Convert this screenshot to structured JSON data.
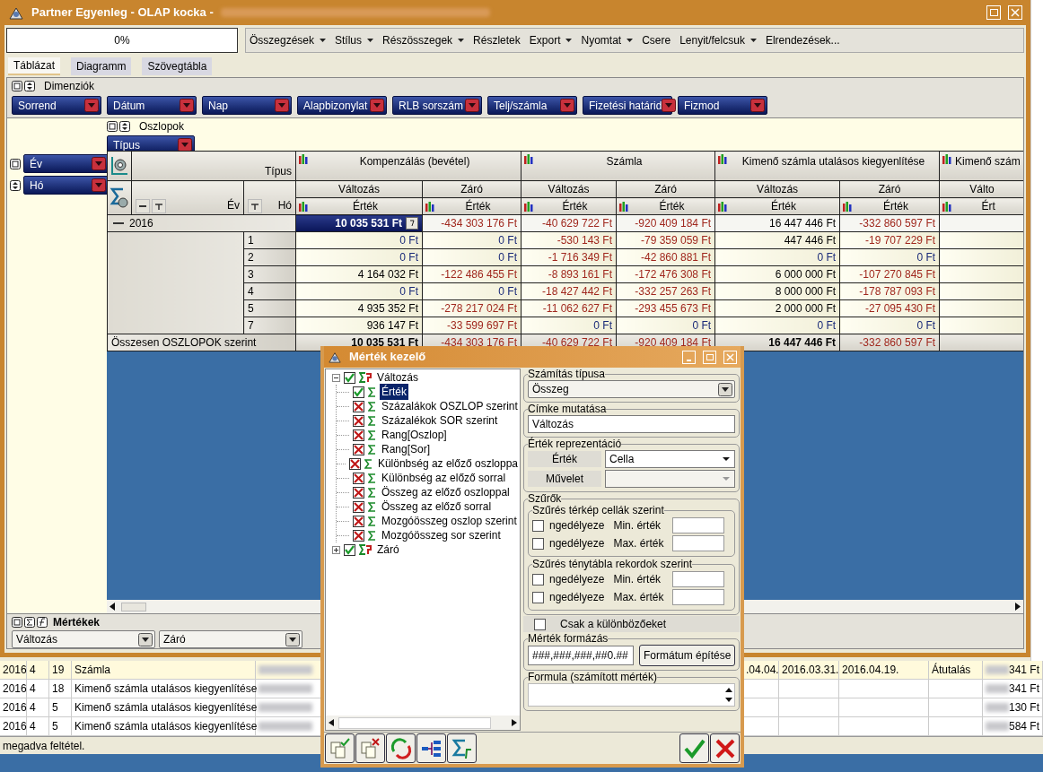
{
  "background_table": {
    "rows": [
      {
        "selected": true,
        "column_1": "2016",
        "column_2": "4",
        "column_3": "19",
        "column_4": "Számla",
        "column_6": ".04.04.",
        "column_7": "2016.03.31.",
        "column_8": "2016.04.19.",
        "column_9": "Átutalás",
        "column_10": "341 Ft"
      },
      {
        "selected": false,
        "column_1": "2016",
        "column_2": "4",
        "column_3": "18",
        "column_4": "Kimenő számla utalásos kiegyenlítése",
        "column_10": "341 Ft"
      },
      {
        "selected": false,
        "column_1": "2016",
        "column_2": "4",
        "column_3": "5",
        "column_4": "Kimenő számla utalásos kiegyenlítése",
        "column_10": "130 Ft"
      },
      {
        "selected": false,
        "column_1": "2016",
        "column_2": "4",
        "column_3": "5",
        "column_4": "Kimenő számla utalásos kiegyenlítése",
        "column_10": "584 Ft"
      }
    ],
    "status_bar": "megadva feltétel."
  },
  "main_window": {
    "title": "Partner Egyenleg - OLAP kocka -",
    "progress": "0%",
    "menu": [
      {
        "label": "Összegzések",
        "dropdown": true
      },
      {
        "label": "Stílus",
        "dropdown": true
      },
      {
        "label": "Részösszegek",
        "dropdown": true
      },
      {
        "label": "Részletek",
        "dropdown": false
      },
      {
        "label": "Export",
        "dropdown": true
      },
      {
        "label": "Nyomtat",
        "dropdown": true
      },
      {
        "label": "Csere",
        "dropdown": false
      },
      {
        "label": "Lenyit/felcsuk",
        "dropdown": true
      },
      {
        "label": "Elrendezések...",
        "dropdown": false
      }
    ],
    "tabs": [
      {
        "label": "Táblázat",
        "selected": true
      },
      {
        "label": "Diagramm",
        "selected": false
      },
      {
        "label": "Szövegtábla",
        "selected": false
      }
    ],
    "dimensions": {
      "title": "Dimenziók",
      "fields": [
        "Sorrend",
        "Dátum",
        "Nap",
        "Alapbizonylat",
        "RLB sorszám",
        "Telj/számla",
        "Fizetési határid",
        "Fizmod"
      ]
    },
    "columns_area": {
      "title": "Oszlopok",
      "fields": [
        "Típus"
      ]
    },
    "row_fields": [
      "Év",
      "Hó"
    ],
    "pivot": {
      "column_field": "Típus",
      "row_labels": [
        "Év",
        "Hó"
      ],
      "groups": [
        {
          "label": "Kompenzálás (bevétel)",
          "measures": [
            {
              "label": "Változás",
              "sub": "Érték"
            },
            {
              "label": "Záró",
              "sub": "Érték"
            }
          ]
        },
        {
          "label": "Számla",
          "measures": [
            {
              "label": "Változás",
              "sub": "Érték"
            },
            {
              "label": "Záró",
              "sub": "Érték"
            }
          ]
        },
        {
          "label": "Kimenő számla utalásos kiegyenlítése",
          "measures": [
            {
              "label": "Változás",
              "sub": "Érték"
            },
            {
              "label": "Záró",
              "sub": "Érték"
            }
          ]
        },
        {
          "label": "Kimenő szám",
          "measures": [
            {
              "label": "Válto",
              "sub": "Ért"
            }
          ]
        }
      ],
      "year": {
        "label": "2016",
        "cells": [
          {
            "value": "10 035 531 Ft",
            "selected": true
          },
          {
            "value": "-434 303 176 Ft",
            "color": "#a0281e",
            "selected": false
          },
          {
            "value": "-40 629 722 Ft",
            "color": "#a0281e",
            "selected": false
          },
          {
            "value": "-920 409 184 Ft",
            "color": "#a0281e",
            "selected": false
          },
          {
            "value": "16 447 446 Ft",
            "color": "#000000",
            "selected": false
          },
          {
            "value": "-332 860 597 Ft",
            "color": "#a0281e",
            "selected": false
          }
        ]
      },
      "months": [
        {
          "label": "1",
          "cells": [
            {
              "value": "0 Ft",
              "color": "#1a2a78",
              "selected": false
            },
            {
              "value": "0 Ft",
              "color": "#1a2a78",
              "selected": false
            },
            {
              "value": "-530 143 Ft",
              "color": "#a0281e",
              "selected": false
            },
            {
              "value": "-79 359 059 Ft",
              "color": "#a0281e",
              "selected": false
            },
            {
              "value": "447 446 Ft",
              "color": "#000000",
              "selected": false
            },
            {
              "value": "-19 707 229 Ft",
              "color": "#a0281e",
              "selected": false
            }
          ]
        },
        {
          "label": "2",
          "cells": [
            {
              "value": "0 Ft",
              "color": "#1a2a78",
              "selected": false
            },
            {
              "value": "0 Ft",
              "color": "#1a2a78",
              "selected": false
            },
            {
              "value": "-1 716 349 Ft",
              "color": "#a0281e",
              "selected": false
            },
            {
              "value": "-42 860 881 Ft",
              "color": "#a0281e",
              "selected": false
            },
            {
              "value": "0 Ft",
              "color": "#1a2a78",
              "selected": false
            },
            {
              "value": "0 Ft",
              "color": "#1a2a78",
              "selected": false
            }
          ]
        },
        {
          "label": "3",
          "cells": [
            {
              "value": "4 164 032 Ft",
              "color": "#000000",
              "selected": false
            },
            {
              "value": "-122 486 455 Ft",
              "color": "#a0281e",
              "selected": false
            },
            {
              "value": "-8 893 161 Ft",
              "color": "#a0281e",
              "selected": false
            },
            {
              "value": "-172 476 308 Ft",
              "color": "#a0281e",
              "selected": false
            },
            {
              "value": "6 000 000 Ft",
              "color": "#000000",
              "selected": false
            },
            {
              "value": "-107 270 845 Ft",
              "color": "#a0281e",
              "selected": false
            }
          ]
        },
        {
          "label": "4",
          "cells": [
            {
              "value": "0 Ft",
              "color": "#1a2a78",
              "selected": false
            },
            {
              "value": "0 Ft",
              "color": "#1a2a78",
              "selected": false
            },
            {
              "value": "-18 427 442 Ft",
              "color": "#a0281e",
              "selected": false
            },
            {
              "value": "-332 257 263 Ft",
              "color": "#a0281e",
              "selected": false
            },
            {
              "value": "8 000 000 Ft",
              "color": "#000000",
              "selected": false
            },
            {
              "value": "-178 787 093 Ft",
              "color": "#a0281e",
              "selected": false
            }
          ]
        },
        {
          "label": "5",
          "cells": [
            {
              "value": "4 935 352 Ft",
              "color": "#000000",
              "selected": false
            },
            {
              "value": "-278 217 024 Ft",
              "color": "#a0281e",
              "selected": false
            },
            {
              "value": "-11 062 627 Ft",
              "color": "#a0281e",
              "selected": false
            },
            {
              "value": "-293 455 673 Ft",
              "color": "#a0281e",
              "selected": false
            },
            {
              "value": "2 000 000 Ft",
              "color": "#000000",
              "selected": false
            },
            {
              "value": "-27 095 430 Ft",
              "color": "#a0281e",
              "selected": false
            }
          ]
        },
        {
          "label": "7",
          "cells": [
            {
              "value": "936 147 Ft",
              "color": "#000000",
              "selected": false
            },
            {
              "value": "-33 599 697 Ft",
              "color": "#a0281e",
              "selected": false
            },
            {
              "value": "0 Ft",
              "color": "#1a2a78",
              "selected": false
            },
            {
              "value": "0 Ft",
              "color": "#1a2a78",
              "selected": false
            },
            {
              "value": "0 Ft",
              "color": "#1a2a78",
              "selected": false
            },
            {
              "value": "0 Ft",
              "color": "#1a2a78",
              "selected": false
            }
          ]
        }
      ],
      "total": {
        "label": "Összesen OSZLOPOK szerint",
        "cells": [
          {
            "value": "10 035 531 Ft",
            "color": "#000000",
            "bold": true,
            "selected": false
          },
          {
            "value": "-434 303 176 Ft",
            "color": "#a0281e",
            "bold": false,
            "selected": false
          },
          {
            "value": "-40 629 722 Ft",
            "color": "#a0281e",
            "bold": false,
            "selected": false
          },
          {
            "value": "-920 409 184 Ft",
            "color": "#a0281e",
            "bold": false,
            "selected": false
          },
          {
            "value": "16 447 446 Ft",
            "color": "#000000",
            "bold": true,
            "selected": false
          },
          {
            "value": "-332 860 597 Ft",
            "color": "#a0281e",
            "bold": false,
            "selected": false
          }
        ]
      }
    },
    "measures": {
      "title": "Mértékek",
      "fields": [
        "Változás",
        "Záró"
      ]
    }
  },
  "dialog": {
    "title": "Mérték kezelő",
    "tree": [
      {
        "label": "Változás",
        "checked": true,
        "selected": false,
        "expanded": true,
        "children": [
          {
            "label": "Érték",
            "checked": true,
            "selected": true
          },
          {
            "label": "Százalákok OSZLOP szerint",
            "checked": false,
            "selected": false
          },
          {
            "label": "Százalékok SOR szerint",
            "checked": false,
            "selected": false
          },
          {
            "label": "Rang[Oszlop]",
            "checked": false,
            "selected": false
          },
          {
            "label": "Rang[Sor]",
            "checked": false,
            "selected": false
          },
          {
            "label": "Különbség az előző oszloppa",
            "checked": false,
            "selected": false
          },
          {
            "label": "Különbség az előző sorral",
            "checked": false,
            "selected": false
          },
          {
            "label": "Összeg az előző oszloppal",
            "checked": false,
            "selected": false
          },
          {
            "label": "Összeg az előző sorral",
            "checked": false,
            "selected": false
          },
          {
            "label": "Mozgóösszeg oszlop szerint",
            "checked": false,
            "selected": false
          },
          {
            "label": "Mozgóösszeg sor szerint",
            "checked": false,
            "selected": false
          }
        ]
      },
      {
        "label": "Záró",
        "checked": true,
        "selected": false,
        "expanded": false
      }
    ],
    "calc_type": {
      "legend": "Számítás típusa",
      "value": "Összeg"
    },
    "label_display": {
      "legend": "Címke mutatása",
      "value": "Változás"
    },
    "representation": {
      "legend": "Érték reprezentáció",
      "rows": [
        {
          "label": "Érték",
          "value": "Cella",
          "disabled": false
        },
        {
          "label": "Művelet",
          "disabled": true
        }
      ]
    },
    "filters": {
      "legend": "Szűrők",
      "groups": [
        {
          "legend": "Szűrés térkép cellák szerint",
          "rows": [
            {
              "check_label": "ngedélyeze",
              "checked": false,
              "label": "Min. érték"
            },
            {
              "check_label": "ngedélyeze",
              "checked": false,
              "label": "Max. érték"
            }
          ]
        },
        {
          "legend": "Szűrés ténytábla rekordok szerint",
          "rows": [
            {
              "check_label": "ngedélyeze",
              "checked": false,
              "label": "Min. érték"
            },
            {
              "check_label": "ngedélyeze",
              "checked": false,
              "label": "Max. érték"
            }
          ]
        }
      ]
    },
    "distinct": {
      "label": "Csak a különbözőeket",
      "checked": false
    },
    "format": {
      "legend": "Mérték formázás",
      "value": "###,###,###,##0.##",
      "button": "Formátum építése"
    },
    "formula": {
      "legend": "Formula (számított mérték)"
    }
  }
}
